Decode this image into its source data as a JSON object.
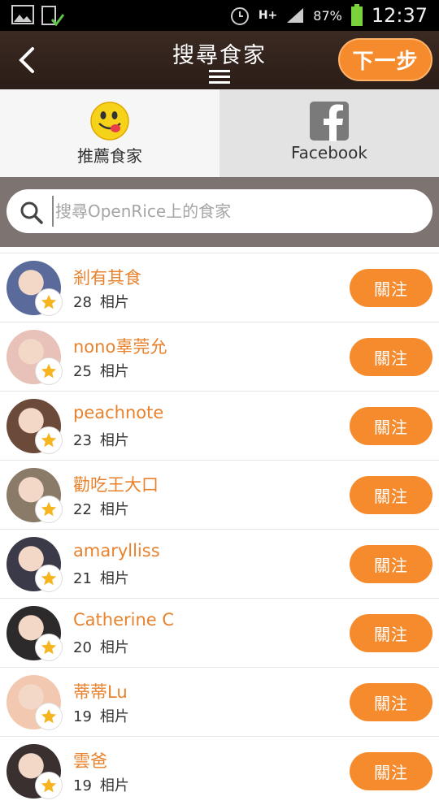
{
  "status_bar": {
    "battery": "87%",
    "time": "12:37",
    "network": "H+"
  },
  "header": {
    "title": "搜尋食家",
    "next_label": "下一步"
  },
  "tabs": [
    {
      "label": "推薦食家",
      "icon": "smiley-icon",
      "active": true
    },
    {
      "label": "Facebook",
      "icon": "facebook-icon",
      "active": false
    }
  ],
  "search": {
    "placeholder": "搜尋OpenRice上的食家"
  },
  "list": {
    "follow_label": "關注",
    "photo_unit": "相片",
    "items": [
      {
        "name": "剎有其食",
        "photos": "28",
        "avatar_color": "#5a6a9a"
      },
      {
        "name": "nono辜莞允",
        "photos": "25",
        "avatar_color": "#e8c2b8"
      },
      {
        "name": "peachnote",
        "photos": "23",
        "avatar_color": "#6b4a3a"
      },
      {
        "name": "勸吃王大口",
        "photos": "22",
        "avatar_color": "#8a7a68"
      },
      {
        "name": "amarylliss",
        "photos": "21",
        "avatar_color": "#3b3a48"
      },
      {
        "name": "Catherine C",
        "photos": "20",
        "avatar_color": "#2d2a2c"
      },
      {
        "name": "蒂蒂Lu",
        "photos": "19",
        "avatar_color": "#f2c9b0"
      },
      {
        "name": "雲爸",
        "photos": "19",
        "avatar_color": "#3a3030"
      }
    ]
  },
  "colors": {
    "accent": "#f58b2c",
    "name_text": "#e8822d",
    "header_bg": "#2b1d17"
  }
}
